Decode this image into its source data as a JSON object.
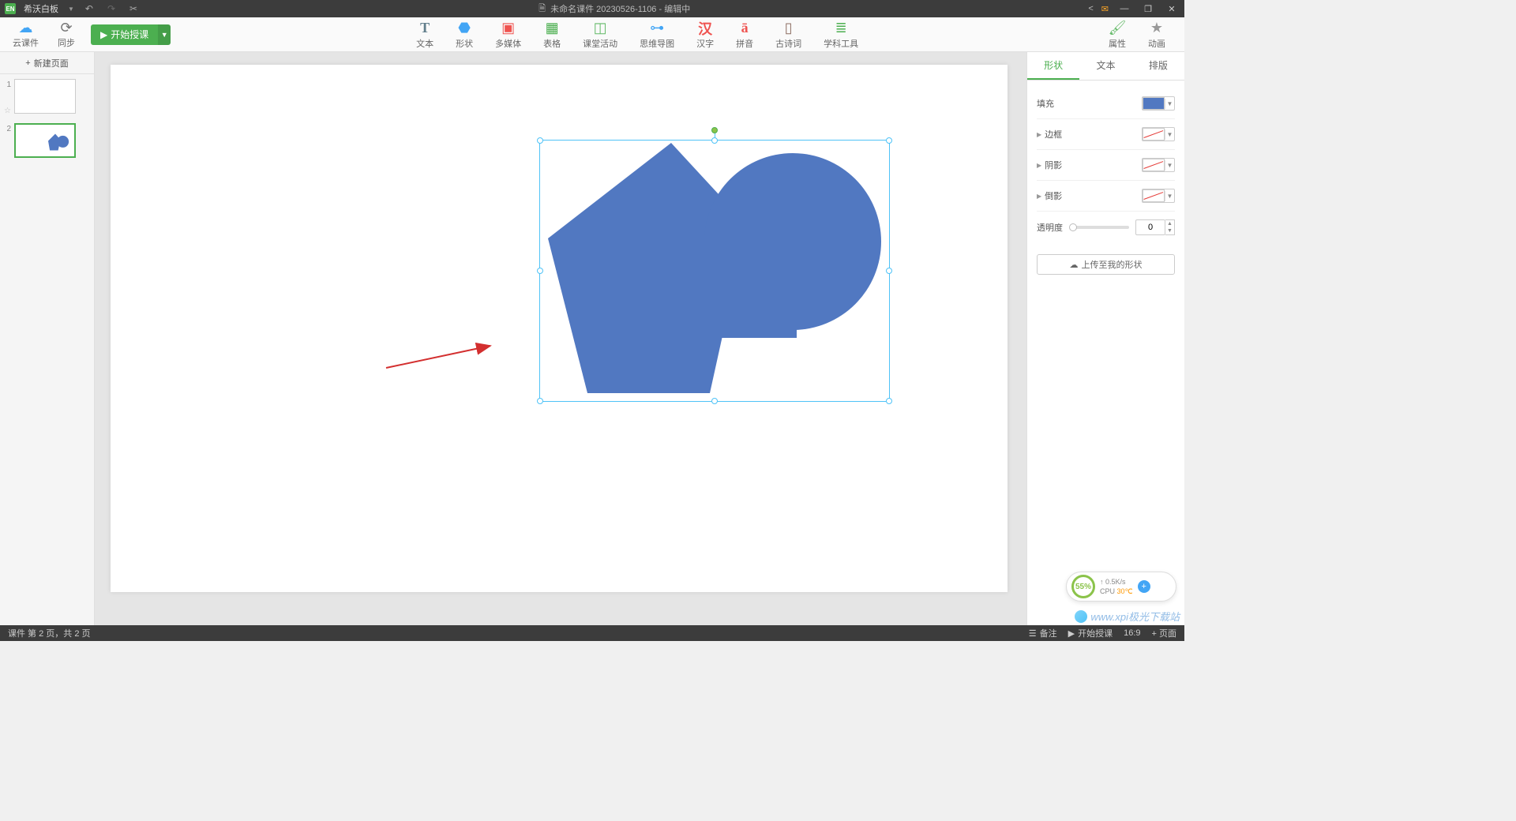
{
  "titlebar": {
    "app_logo": "EN",
    "app_name": "希沃白板",
    "doc_title": "未命名课件 20230526-1106 - 编辑中"
  },
  "ribbon": {
    "cloud": "云课件",
    "sync": "同步",
    "start_lesson": "开始授课",
    "tools": {
      "text": "文本",
      "shape": "形状",
      "media": "多媒体",
      "table": "表格",
      "activity": "课堂活动",
      "mindmap": "思维导图",
      "hanzi": "汉字",
      "pinyin": "拼音",
      "poem": "古诗词",
      "subject": "学科工具"
    },
    "right": {
      "attr": "属性",
      "anim": "动画"
    }
  },
  "thumbs": {
    "new_page": "新建页面",
    "pages": [
      {
        "num": "1"
      },
      {
        "num": "2"
      }
    ]
  },
  "props": {
    "tabs": {
      "shape": "形状",
      "text": "文本",
      "layout": "排版"
    },
    "fill": "填充",
    "border": "边框",
    "shadow": "阴影",
    "reflection": "倒影",
    "opacity": "透明度",
    "opacity_value": "0",
    "upload": "上传至我的形状"
  },
  "status": {
    "left": "课件 第 2 页，共 2 页",
    "remark": "备注",
    "start": "开始授课",
    "ratio": "16:9",
    "add_page": "+ 页面"
  },
  "sysmon": {
    "percent": "55%",
    "net": "0.5K/s",
    "cpu": "CPU",
    "temp": "30℃"
  },
  "watermark": "www.xpi极光下载站"
}
